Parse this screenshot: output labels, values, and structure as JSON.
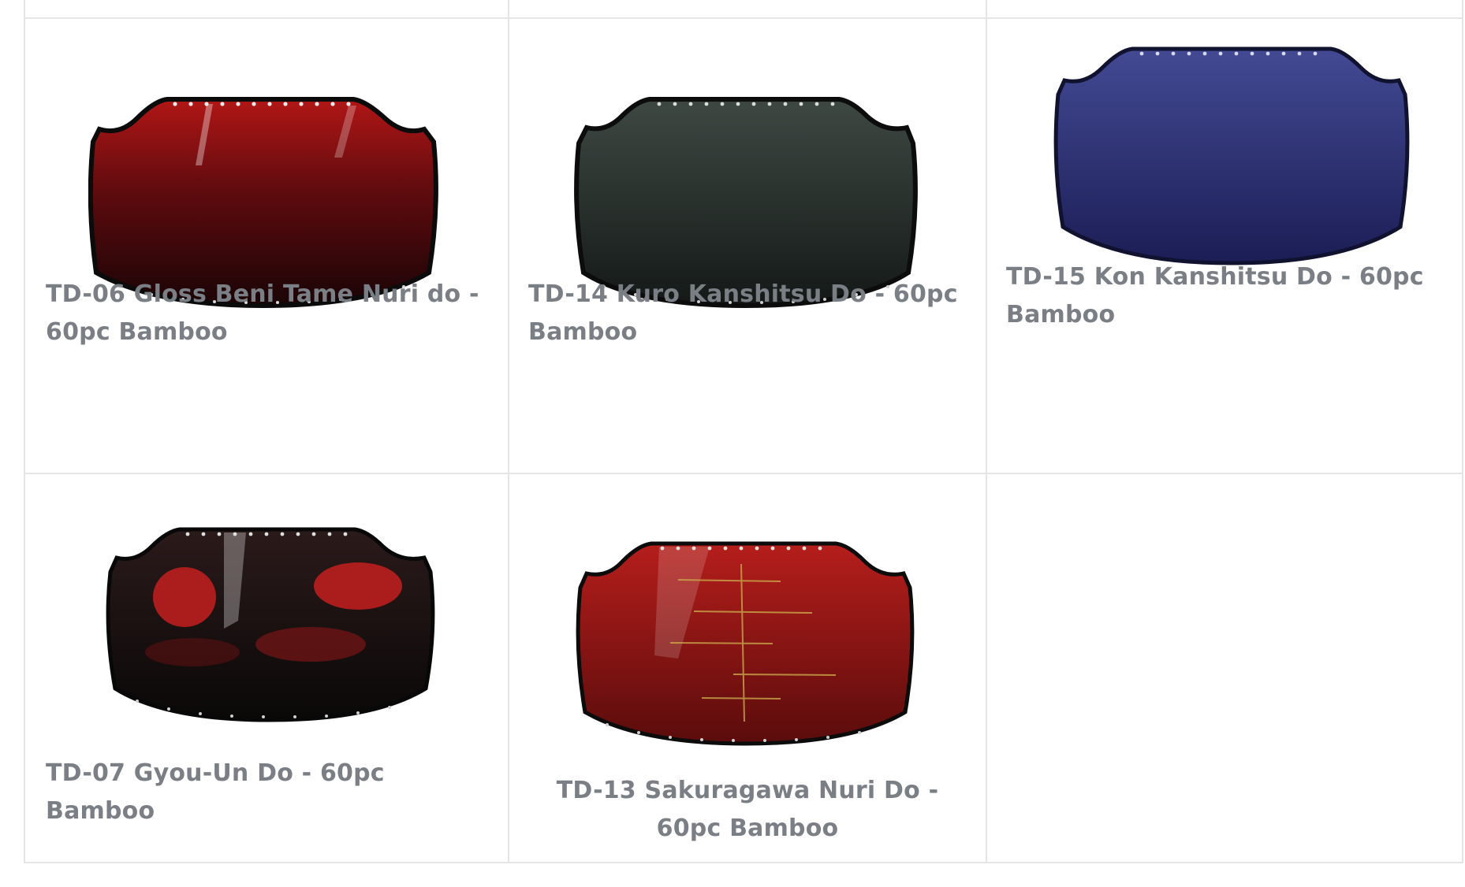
{
  "products": [
    {
      "title": "TD-06 Gloss Beni Tame Nuri do - 60pc Bamboo",
      "image_icon": "kendo-do-armor-icon",
      "colors": {
        "top": "#a31212",
        "bottom": "#1c0506",
        "rim": "#0b0b0b"
      }
    },
    {
      "title": "TD-14 Kuro Kanshitsu Do - 60pc Bamboo",
      "image_icon": "kendo-do-armor-icon",
      "colors": {
        "top": "#3b4440",
        "bottom": "#161b19",
        "rim": "#0c0c0c"
      }
    },
    {
      "title": "TD-15 Kon Kanshitsu Do - 60pc Bamboo",
      "image_icon": "kendo-do-armor-icon",
      "colors": {
        "top": "#3a3f86",
        "bottom": "#1a1c52",
        "rim": "#10122e"
      }
    },
    {
      "title": "TD-07 Gyou-Un Do - 60pc Bamboo",
      "image_icon": "kendo-do-armor-icon",
      "colors": {
        "top": "#2a1a1a",
        "bottom": "#0d0a0a",
        "rim": "#080808",
        "accent": "#c0201f"
      }
    },
    {
      "title": "TD-13 Sakuragawa Nuri Do - 60pc Bamboo",
      "image_icon": "kendo-do-armor-icon",
      "colors": {
        "top": "#b31c1a",
        "bottom": "#5a0c0c",
        "rim": "#0c0c0c",
        "accent": "#c9a84a"
      }
    }
  ]
}
